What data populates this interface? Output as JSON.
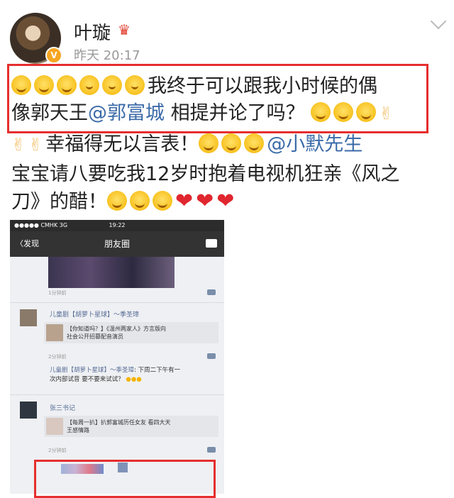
{
  "post": {
    "username": "叶璇",
    "time": "昨天 20:17",
    "line1_text": "我终于可以跟我小时候的偶",
    "line2_pre": "像郭天王",
    "line2_mention": "@郭富城",
    "line2_post": " 相提并论了吗？",
    "line3_text": "幸福得无以言表！",
    "line3_mention": "@小默先生",
    "line4_text": "宝宝请八要吃我12岁时抱着电视机狂亲《风之",
    "line5_text": "刀》的醋！"
  },
  "shot": {
    "status_left": "●●●●● CMHK  3G",
    "status_time": "19:22",
    "nav_back": "〈发现",
    "nav_title": "朋友圈",
    "time1": "1分钟前",
    "user1": "儿童剧【胡萝卜星球】～季圣璋",
    "share1_line1": "【你知道吗？】《温州两家人》方言版向",
    "share1_line2": "社会公开招募配音演员",
    "time2": "2分钟前",
    "comment1_name": "儿童剧【胡萝卜星球】～季圣璋",
    "comment1_text1": ": 下周二下午有一",
    "comment1_text2": "次内部试音 要不要来试试？",
    "user2": "张三书记",
    "share2_line1": "【每周一扒】扒郭富城历任女友 看四大天",
    "share2_line2": "王感情路",
    "time3": "2分钟前"
  },
  "colors": {
    "highlight_box": "#e62e2e",
    "mention": "#3b6aa8"
  }
}
